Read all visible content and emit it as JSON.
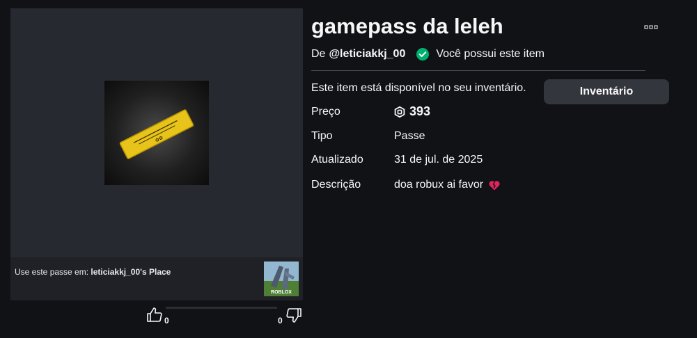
{
  "item": {
    "title": "gamepass da leleh",
    "by_prefix": "De",
    "creator": "@leticiakkj_00",
    "owned_text": "Você possui este item",
    "available_text": "Este item está disponível no seu inventário.",
    "inventory_button": "Inventário"
  },
  "details": {
    "price_label": "Preço",
    "price_value": "393",
    "type_label": "Tipo",
    "type_value": "Passe",
    "updated_label": "Atualizado",
    "updated_value": "31 de jul. de 2025",
    "description_label": "Descrição",
    "description_value": "doa robux ai favor"
  },
  "place": {
    "prefix": "Use este passe em: ",
    "name": "leticiakkj_00's Place",
    "thumb_text": "ROBLOX"
  },
  "votes": {
    "up_count": "0",
    "down_count": "0"
  },
  "colors": {
    "background": "#111216",
    "panel": "#272930",
    "owned_check": "#00b06f",
    "pass_gold": "#e8c31a",
    "button": "#34363d"
  },
  "icons": {
    "more": "more-dots-icon",
    "owned": "check-circle-icon",
    "currency": "robux-icon",
    "description_emoji": "broken-heart-icon",
    "like": "thumbs-up-icon",
    "dislike": "thumbs-down-icon"
  }
}
